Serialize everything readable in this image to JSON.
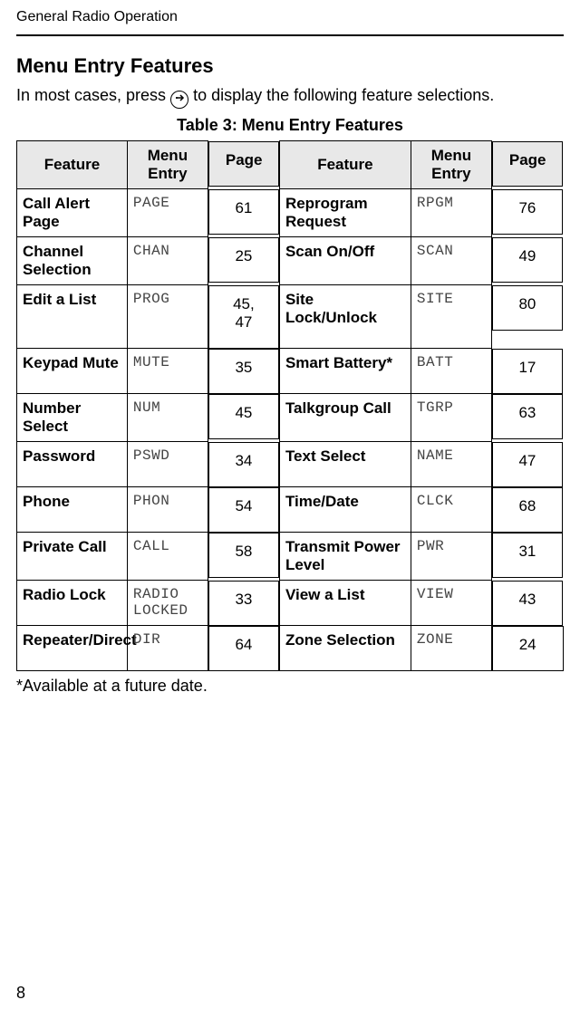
{
  "header": {
    "running_head": "General Radio Operation"
  },
  "section": {
    "title": "Menu Entry Features",
    "intro_pre": "In most cases, press ",
    "intro_post": " to display the following feature selections.",
    "icon_name": "u-select-icon"
  },
  "table": {
    "caption": "Table 3: Menu Entry Features",
    "columns": {
      "feature": "Feature",
      "menu_entry": "Menu Entry",
      "page": "Page"
    },
    "rows": [
      {
        "f1": "Call Alert Page",
        "m1": "PAGE",
        "p1": "61",
        "f2": "Reprogram Request",
        "m2": "RPGM",
        "p2": "76"
      },
      {
        "f1": "Channel Selection",
        "m1": "CHAN",
        "p1": "25",
        "f2": "Scan On/Off",
        "m2": "SCAN",
        "p2": "49"
      },
      {
        "f1": "Edit a List",
        "m1": "PROG",
        "p1": "45, 47",
        "f2": "Site Lock/Unlock",
        "m2": "SITE",
        "p2": "80"
      },
      {
        "f1": "Keypad Mute",
        "m1": "MUTE",
        "p1": "35",
        "f2": "Smart Battery*",
        "m2": "BATT",
        "p2": "17"
      },
      {
        "f1": "Number Select",
        "m1": "NUM",
        "p1": "45",
        "f2": "Talkgroup Call",
        "m2": "TGRP",
        "p2": "63"
      },
      {
        "f1": "Password",
        "m1": "PSWD",
        "p1": "34",
        "f2": "Text Select",
        "m2": "NAME",
        "p2": "47"
      },
      {
        "f1": "Phone",
        "m1": "PHON",
        "p1": "54",
        "f2": "Time/Date",
        "m2": "CLCK",
        "p2": "68"
      },
      {
        "f1": "Private Call",
        "m1": "CALL",
        "p1": "58",
        "f2": "Transmit Power Level",
        "m2": "PWR",
        "p2": "31"
      },
      {
        "f1": "Radio Lock",
        "m1": "RADIO LOCKED",
        "p1": "33",
        "f2": "View a List",
        "m2": "VIEW",
        "p2": "43"
      },
      {
        "f1": "Repeater/Direct",
        "m1": "DIR",
        "p1": "64",
        "f2": "Zone Selection",
        "m2": "ZONE",
        "p2": "24"
      }
    ]
  },
  "footnote": "*Available at a future date.",
  "page_number": "8"
}
